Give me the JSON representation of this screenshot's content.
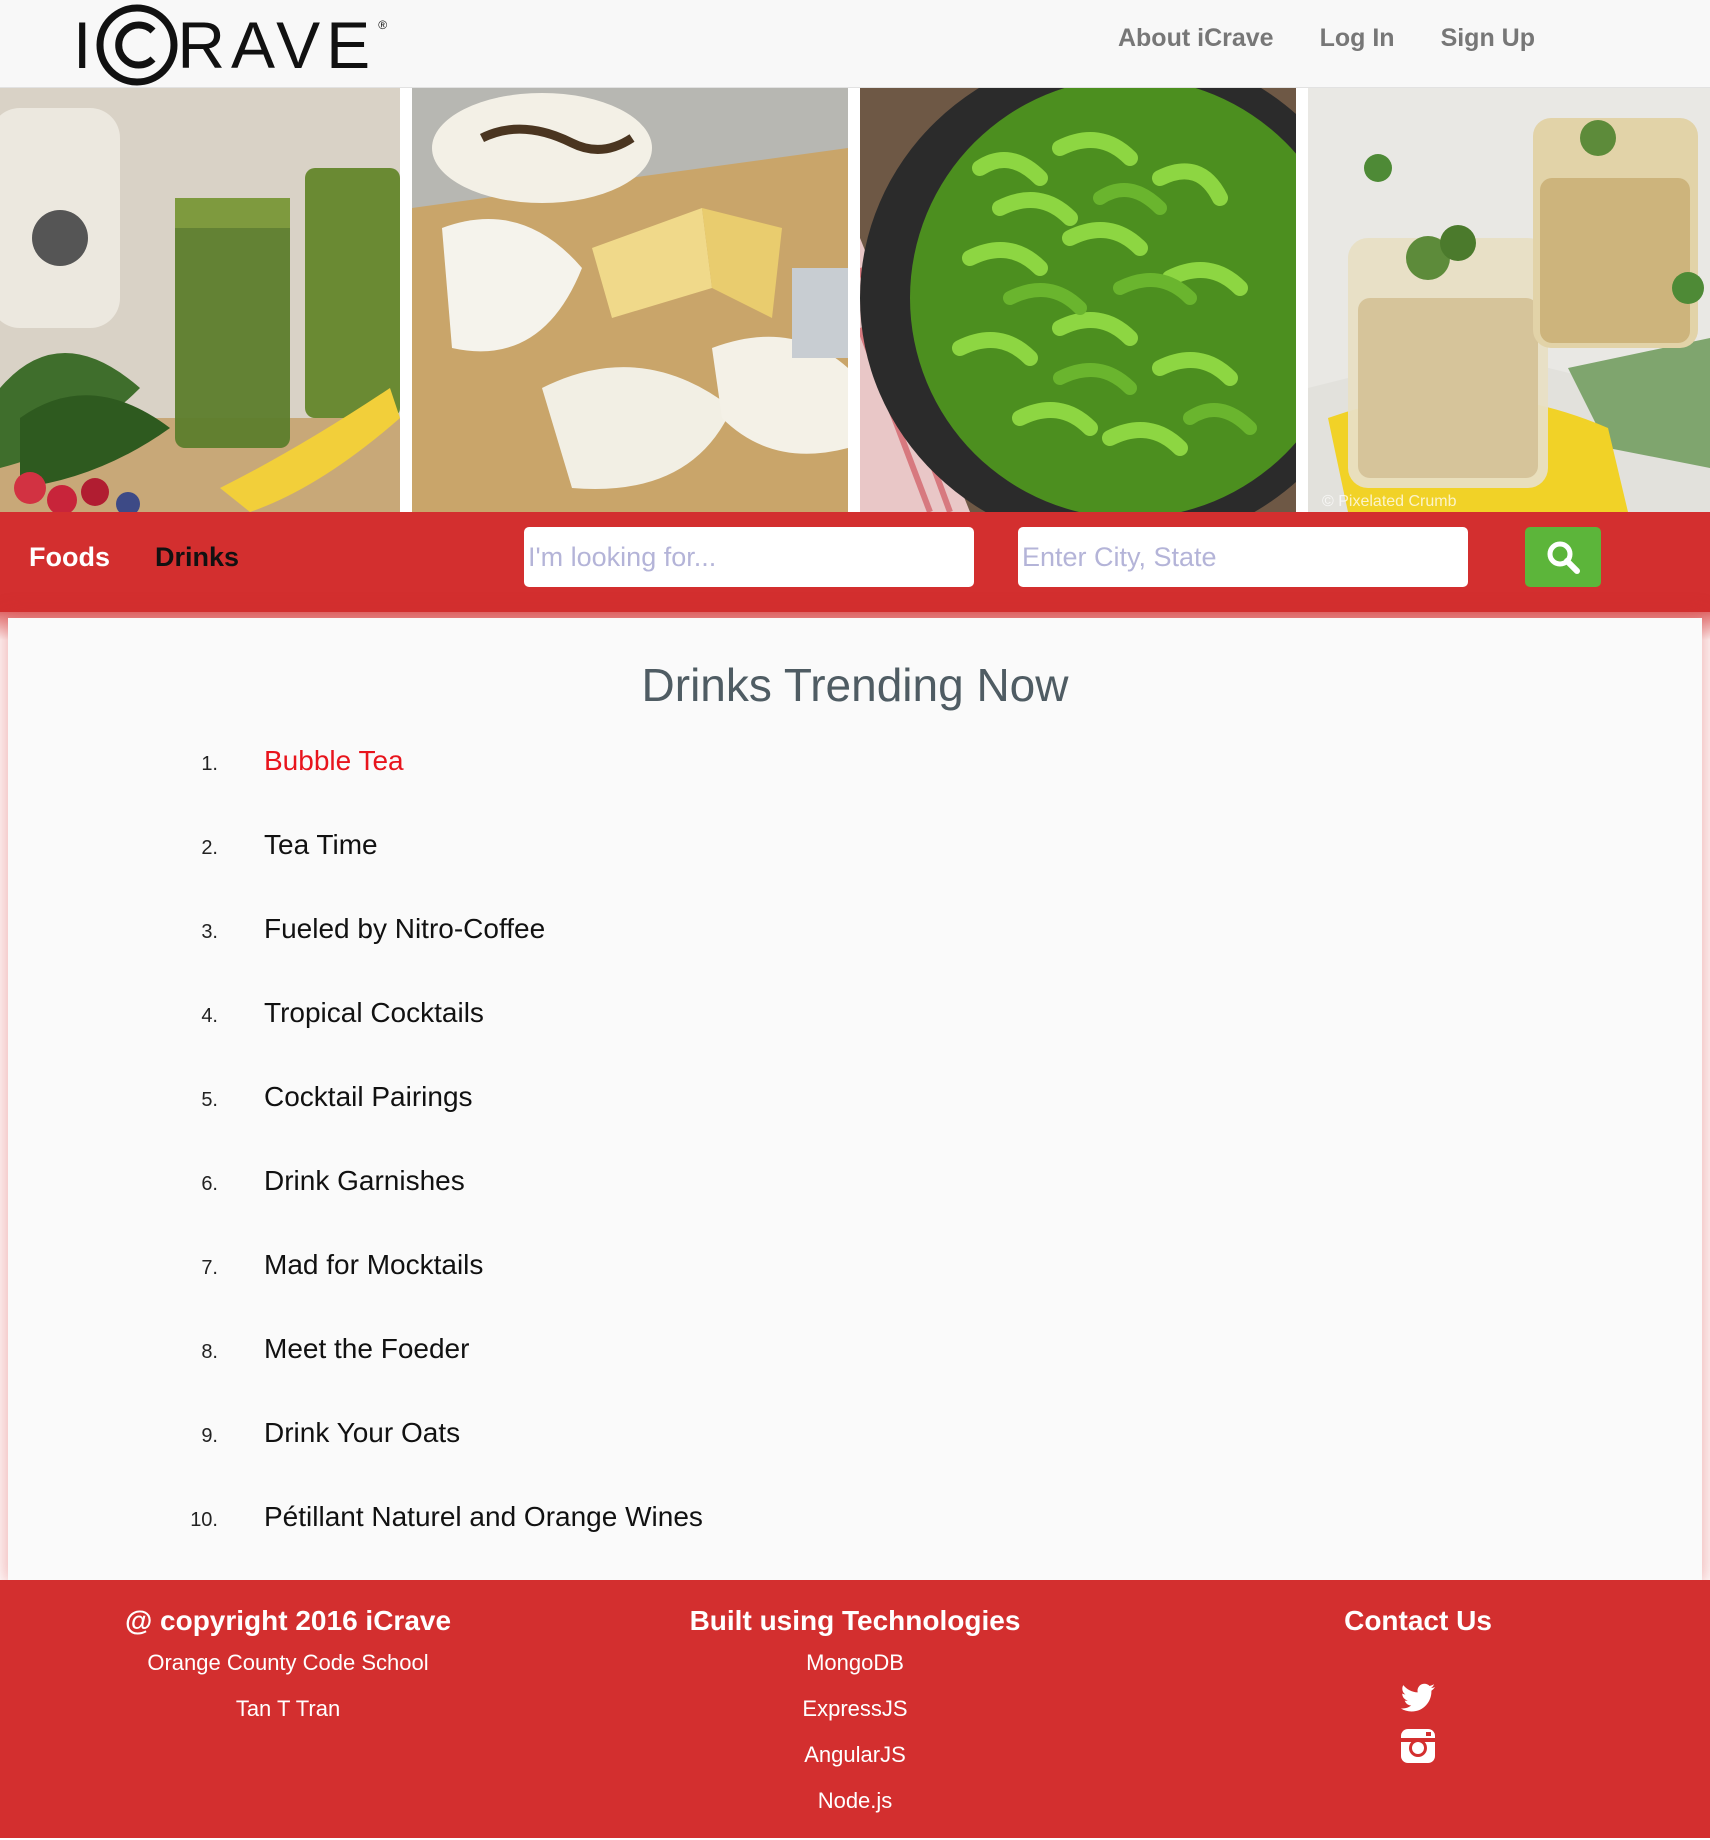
{
  "brand": {
    "logo_left": "I",
    "logo_right": "RAVE",
    "logo_mark": "®"
  },
  "topnav": {
    "links": [
      "About iCrave",
      "Log In",
      "Sign Up"
    ]
  },
  "hero": {
    "photos": [
      "green-smoothie-photo",
      "cheese-board-photo",
      "edamame-pan-photo",
      "mint-julep-photo"
    ],
    "watermark": "© Pixelated Crumb"
  },
  "searchbar": {
    "categories": [
      "Foods",
      "Drinks"
    ],
    "what_placeholder": "I'm looking for...",
    "where_placeholder": "Enter City, State",
    "search_icon": "search-icon",
    "bg_color": "#d32f2f",
    "button_color": "#5cb53a"
  },
  "main": {
    "title": "Drinks Trending Now",
    "items": [
      {
        "num": "1.",
        "label": "Bubble Tea"
      },
      {
        "num": "2.",
        "label": "Tea Time"
      },
      {
        "num": "3.",
        "label": "Fueled by Nitro-Coffee"
      },
      {
        "num": "4.",
        "label": "Tropical Cocktails"
      },
      {
        "num": "5.",
        "label": "Cocktail Pairings"
      },
      {
        "num": "6.",
        "label": "Drink Garnishes"
      },
      {
        "num": "7.",
        "label": "Mad for Mocktails"
      },
      {
        "num": "8.",
        "label": "Meet the Foeder"
      },
      {
        "num": "9.",
        "label": "Drink Your Oats"
      },
      {
        "num": "10.",
        "label": "Pétillant Naturel and Orange Wines"
      }
    ],
    "active_color": "#e8141c"
  },
  "footer": {
    "col1": {
      "title": "@ copyright 2016 iCrave",
      "lines": [
        "Orange County Code School",
        "Tan T Tran"
      ]
    },
    "col2": {
      "title": "Built using Technologies",
      "lines": [
        "MongoDB",
        "ExpressJS",
        "AngularJS",
        "Node.js"
      ]
    },
    "col3": {
      "title": "Contact Us",
      "icons": [
        "twitter-icon",
        "instagram-icon"
      ]
    }
  }
}
